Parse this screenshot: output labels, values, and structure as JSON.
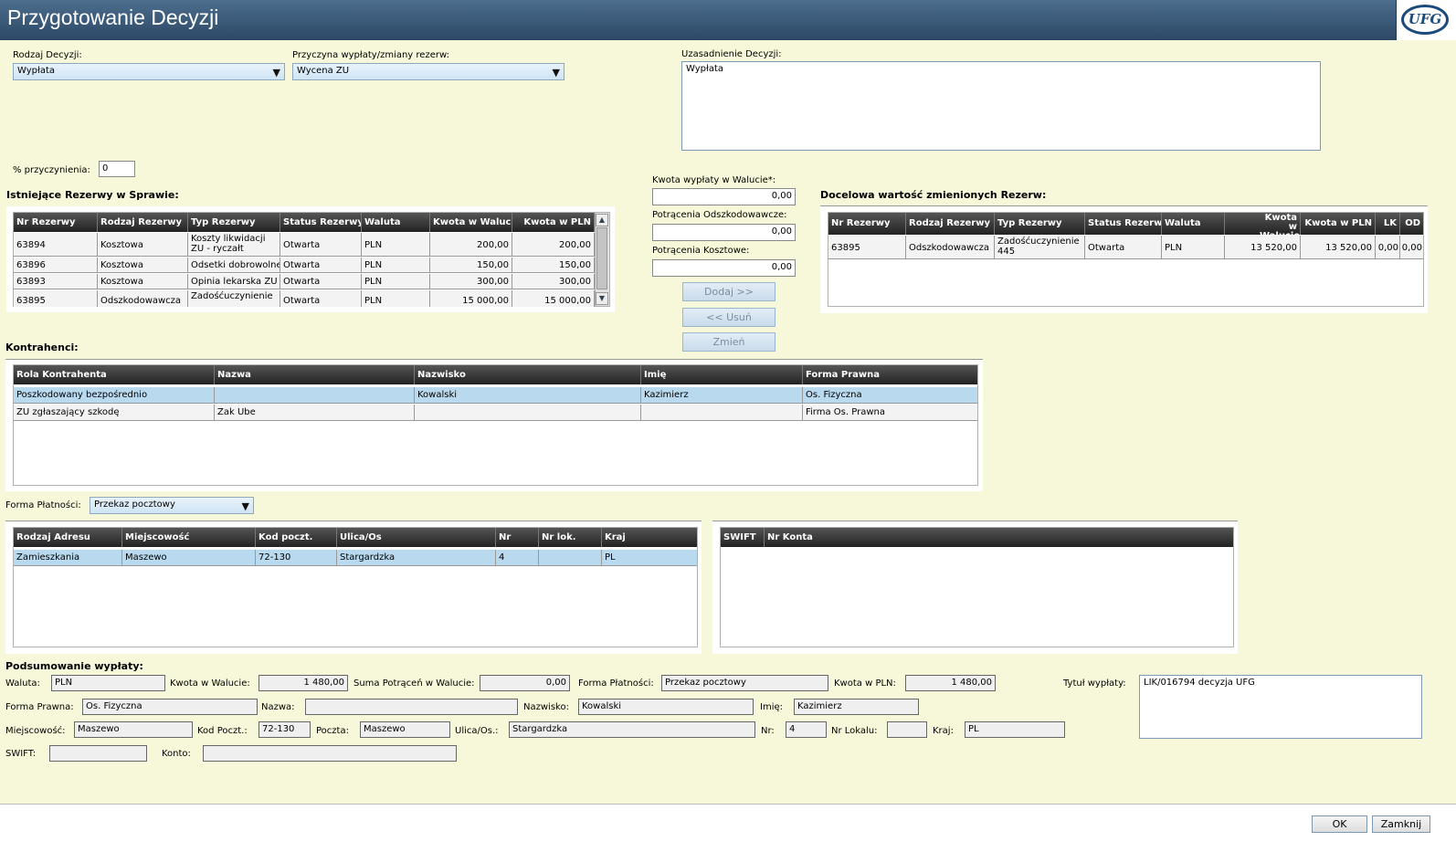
{
  "window": {
    "title": "Przygotowanie Decyzji",
    "logo_text": "UFG"
  },
  "decision": {
    "type_label": "Rodzaj Decyzji:",
    "type_value": "Wypłata",
    "reason_label": "Przyczyna wypłaty/zmiany rezerw:",
    "reason_value": "Wycena ZU",
    "justification_label": "Uzasadnienie Decyzji:",
    "justification_value": "Wypłata",
    "contribution_label": "% przyczynienia:",
    "contribution_value": "0"
  },
  "existing": {
    "title": "Istniejące Rezerwy w Sprawie:",
    "columns": [
      "Nr Rezerwy",
      "Rodzaj Rezerwy",
      "Typ Rezerwy",
      "Status Rezerwy",
      "Waluta",
      "Kwota w Walucie",
      "Kwota w PLN"
    ],
    "rows": [
      [
        "63894",
        "Kosztowa",
        "Koszty likwidacji ZU - ryczałt",
        "Otwarta",
        "PLN",
        "200,00",
        "200,00"
      ],
      [
        "63896",
        "Kosztowa",
        "Odsetki dobrowolne",
        "Otwarta",
        "PLN",
        "150,00",
        "150,00"
      ],
      [
        "63893",
        "Kosztowa",
        "Opinia lekarska ZU",
        "Otwarta",
        "PLN",
        "300,00",
        "300,00"
      ],
      [
        "63895",
        "Odszkodowawcza",
        "Zadośćuczynienie",
        "Otwarta",
        "PLN",
        "15 000,00",
        "15 000,00"
      ]
    ]
  },
  "middle": {
    "payout_label": "Kwota wypłaty w Walucie*:",
    "payout_value": "0,00",
    "comp_label": "Potrącenia Odszkodowawcze:",
    "comp_value": "0,00",
    "cost_label": "Potrącenia Kosztowe:",
    "cost_value": "0,00",
    "add_label": "Dodaj >>",
    "remove_label": "<< Usuń",
    "change_label": "Zmień"
  },
  "target": {
    "title": "Docelowa wartość zmienionych Rezerw:",
    "columns": [
      "Nr Rezerwy",
      "Rodzaj Rezerwy",
      "Typ Rezerwy",
      "Status Rezerwy",
      "Waluta",
      "Kwota w Walucie",
      "Kwota w PLN",
      "LK",
      "OD"
    ],
    "rows": [
      [
        "63895",
        "Odszkodowawcza",
        "Zadośćuczynienie 445",
        "Otwarta",
        "PLN",
        "13 520,00",
        "13 520,00",
        "0,00",
        "0,00"
      ]
    ]
  },
  "contractors": {
    "title": "Kontrahenci:",
    "columns": [
      "Rola Kontrahenta",
      "Nazwa",
      "Nazwisko",
      "Imię",
      "Forma Prawna"
    ],
    "rows": [
      [
        "Poszkodowany bezpośrednio",
        "",
        "Kowalski",
        "Kazimierz",
        "Os. Fizyczna"
      ],
      [
        "ZU zgłaszający szkodę",
        "Zak Ube",
        "",
        "",
        "Firma Os. Prawna"
      ]
    ]
  },
  "payment": {
    "label": "Forma Płatności:",
    "value": "Przekaz pocztowy"
  },
  "addresses": {
    "columns": [
      "Rodzaj Adresu",
      "Miejscowość",
      "Kod poczt.",
      "Ulica/Os",
      "Nr",
      "Nr lok.",
      "Kraj"
    ],
    "rows": [
      [
        "Zamieszkania",
        "Maszewo",
        "72-130",
        "Stargardzka",
        "4",
        "",
        "PL"
      ]
    ]
  },
  "accounts": {
    "columns": [
      "SWIFT",
      "Nr Konta"
    ]
  },
  "summary": {
    "title": "Podsumowanie wypłaty:",
    "currency_label": "Waluta:",
    "currency": "PLN",
    "amount_label": "Kwota w Walucie:",
    "amount": "1 480,00",
    "deductions_label": "Suma Potrąceń w Walucie:",
    "deductions": "0,00",
    "payment_label": "Forma Płatności:",
    "payment": "Przekaz pocztowy",
    "pln_label": "Kwota w PLN:",
    "pln": "1 480,00",
    "title_label": "Tytuł wypłaty:",
    "title_value": "LIK/016794 decyzja UFG",
    "legal_label": "Forma Prawna:",
    "legal": "Os. Fizyczna",
    "name_label": "Nazwa:",
    "name": "",
    "surname_label": "Nazwisko:",
    "surname": "Kowalski",
    "first_label": "Imię:",
    "first": "Kazimierz",
    "city_label": "Miejscowość:",
    "city": "Maszewo",
    "zip_label": "Kod Poczt.:",
    "zip": "72-130",
    "post_label": "Poczta:",
    "post": "Maszewo",
    "street_label": "Ulica/Os.:",
    "street": "Stargardzka",
    "nr_label": "Nr:",
    "nr": "4",
    "local_label": "Nr Lokalu:",
    "local": "",
    "country_label": "Kraj:",
    "country": "PL",
    "swift_label": "SWIFT:",
    "swift": "",
    "account_label": "Konto:",
    "account": ""
  },
  "footer": {
    "ok_label": "OK",
    "close_label": "Zamknij"
  }
}
